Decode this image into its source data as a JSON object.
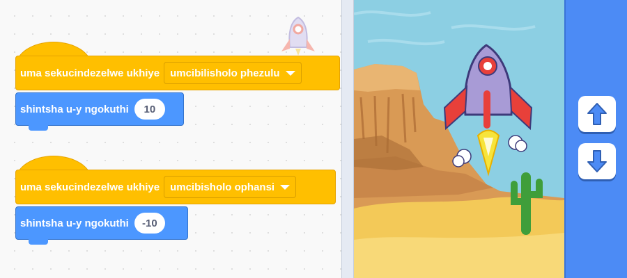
{
  "script1": {
    "hat_label": "uma sekucindezelwe ukhiye",
    "key_dropdown": "umcibilisholo phezulu",
    "motion_label": "shintsha u-y ngokuthi",
    "motion_value": "10"
  },
  "script2": {
    "hat_label": "uma sekucindezelwe ukhiye",
    "key_dropdown": "umcibisholo ophansi",
    "motion_label": "shintsha u-y ngokuthi",
    "motion_value": "-10"
  },
  "stage": {
    "sprite": "rocket-sprite",
    "backdrop": "desert-canyon"
  },
  "controls": {
    "up_button_icon": "arrow-up-icon",
    "down_button_icon": "arrow-down-icon"
  },
  "colors": {
    "events": "#ffbf00",
    "motion": "#4c97ff",
    "side_panel": "#4c8bf5",
    "sky": "#8ccfe3",
    "sand": "#f3c958"
  }
}
